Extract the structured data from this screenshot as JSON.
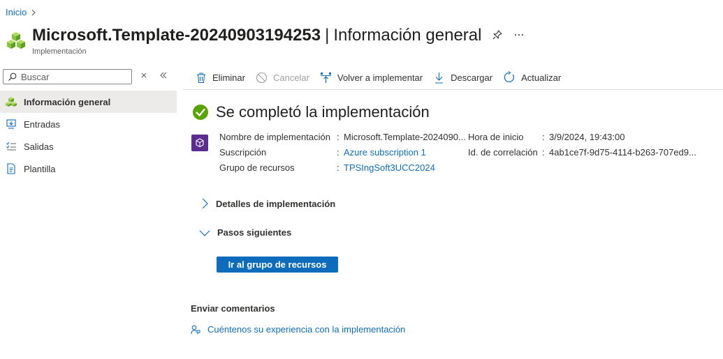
{
  "breadcrumb": {
    "home": "Inicio"
  },
  "header": {
    "title_main": "Microsoft.Template-20240903194253",
    "title_separator": "|",
    "title_sub": "Información general",
    "subtype": "Implementación"
  },
  "sidebar": {
    "search": {
      "placeholder": "Buscar"
    },
    "items": [
      {
        "label": "Información general",
        "icon": "overview-icon",
        "active": true
      },
      {
        "label": "Entradas",
        "icon": "inputs-icon"
      },
      {
        "label": "Salidas",
        "icon": "outputs-icon"
      },
      {
        "label": "Plantilla",
        "icon": "template-icon"
      }
    ]
  },
  "toolbar": {
    "delete": "Eliminar",
    "cancel": "Cancelar",
    "redeploy": "Volver a implementar",
    "download": "Descargar",
    "refresh": "Actualizar"
  },
  "status": {
    "title": "Se completó la implementación",
    "color": "#57a300"
  },
  "properties": {
    "deployment_name_label": "Nombre de implementación",
    "deployment_name_value": "Microsoft.Template-2024090...",
    "subscription_label": "Suscripción",
    "subscription_value": "Azure subscription 1",
    "resource_group_label": "Grupo de recursos",
    "resource_group_value": "TPSIngSoft3UCC2024",
    "start_time_label": "Hora de inicio",
    "start_time_value": "3/9/2024, 19:43:00",
    "correlation_label": "Id. de correlación",
    "correlation_value": "4ab1ce7f-9d75-4114-b263-707ed9...",
    "colon": ":"
  },
  "sections": {
    "details": "Detalles de implementación",
    "next_steps": "Pasos siguientes",
    "go_button": "Ir al grupo de recursos"
  },
  "feedback": {
    "title": "Enviar comentarios",
    "link": "Cuéntenos su experiencia con la implementación"
  },
  "colors": {
    "accent": "#0f6cbd",
    "active_nav_bg": "#edebe9",
    "template_icon_bg": "#5c2d91"
  }
}
